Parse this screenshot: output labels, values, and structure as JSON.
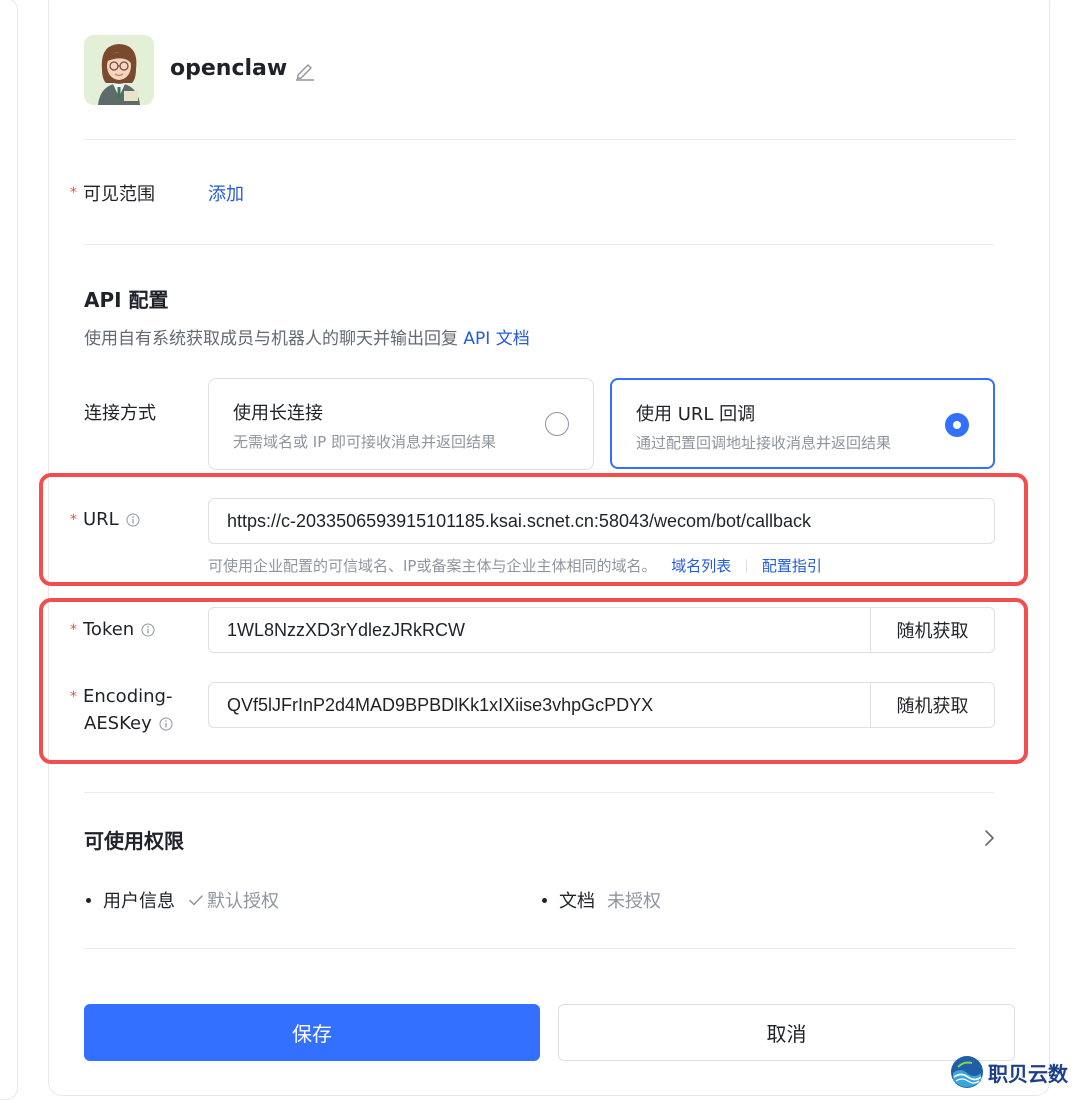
{
  "header": {
    "bot_name": "openclaw",
    "avatar_icon": "avatar-woman-glasses-icon"
  },
  "visibility": {
    "label": "可见范围",
    "required_mark": "*",
    "add_link": "添加"
  },
  "api": {
    "title": "API 配置",
    "description": "使用自有系统获取成员与机器人的聊天并输出回复",
    "doc_link": "API 文档",
    "connection": {
      "label": "连接方式",
      "options": [
        {
          "title": "使用长连接",
          "description": "无需域名或 IP 即可接收消息并返回结果",
          "selected": false
        },
        {
          "title": "使用 URL 回调",
          "description": "通过配置回调地址接收消息并返回结果",
          "selected": true
        }
      ]
    },
    "url": {
      "label": "URL",
      "required_mark": "*",
      "value": "https://c-2033506593915101185.ksai.scnet.cn:58043/wecom/bot/callback",
      "hint": "可使用企业配置的可信域名、IP或备案主体与企业主体相同的域名。",
      "domain_list_link": "域名列表",
      "guide_link": "配置指引"
    },
    "token": {
      "label": "Token",
      "required_mark": "*",
      "value": "1WL8NzzXD3rYdlezJRkRCW",
      "button": "随机获取"
    },
    "aes_key": {
      "label_line1": "Encoding-",
      "label_line2": "AESKey",
      "required_mark": "*",
      "value": "QVf5lJFrInP2d4MAD9BPBDlKk1xIXiise3vhpGcPDYX",
      "button": "随机获取"
    }
  },
  "permissions": {
    "title": "可使用权限",
    "items": [
      {
        "name": "用户信息",
        "status": "默认授权"
      },
      {
        "name": "文档",
        "status": "未授权"
      }
    ]
  },
  "actions": {
    "save": "保存",
    "cancel": "取消"
  },
  "watermark": {
    "text": "职贝云数"
  },
  "colors": {
    "primary": "#3370ff",
    "link": "#245bdb",
    "required": "#f54a45",
    "highlight": "#f24e4e"
  }
}
